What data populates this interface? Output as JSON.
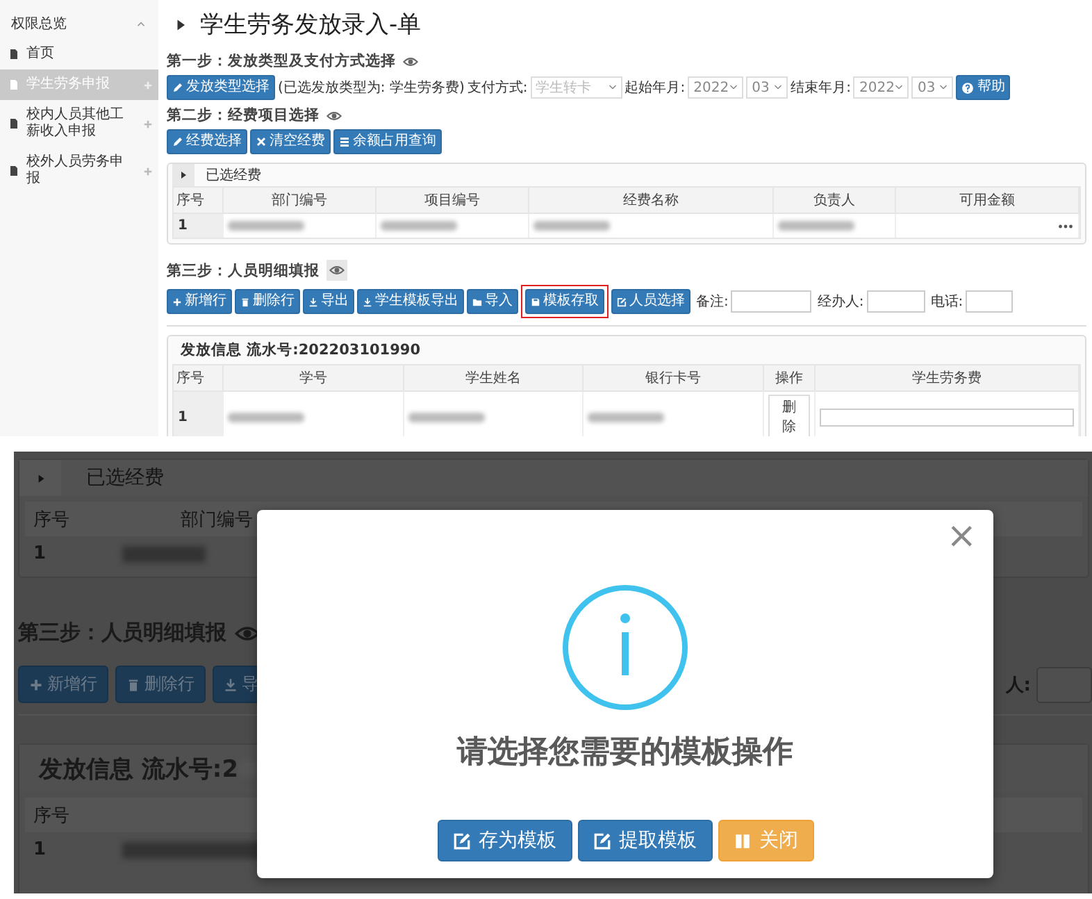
{
  "sidebar": {
    "title": "权限总览",
    "items": [
      {
        "label": "首页",
        "selected": false,
        "expandable": false
      },
      {
        "label": "学生劳务申报",
        "selected": true,
        "expandable": true
      },
      {
        "label": "校内人员其他工薪收入申报",
        "selected": false,
        "expandable": true
      },
      {
        "label": "校外人员劳务申报",
        "selected": false,
        "expandable": true
      }
    ]
  },
  "page_title": "学生劳务发放录入-单",
  "step1": {
    "heading": "第一步：发放类型及支付方式选择",
    "type_button": "发放类型选择",
    "selected_type": "(已选发放类型为: 学生劳务费)",
    "payment_label": "支付方式:",
    "payment_select": {
      "placeholder": "学生转卡"
    },
    "start_label": "起始年月:",
    "start_year": "2022",
    "start_month": "03",
    "end_label": "结束年月:",
    "end_year": "2022",
    "end_month": "03",
    "help_button": "帮助"
  },
  "step2": {
    "heading": "第二步：经费项目选择",
    "buttons": [
      {
        "label": "经费选择"
      },
      {
        "label": "清空经费"
      },
      {
        "label": "余额占用查询"
      }
    ]
  },
  "funds_panel": {
    "title": "已选经费",
    "columns": [
      "序号",
      "部门编号",
      "项目编号",
      "经费名称",
      "负责人",
      "可用金额"
    ],
    "rows": [
      {
        "cells": [
          {
            "kind": "text",
            "text": "1"
          },
          {
            "kind": "blurred"
          },
          {
            "kind": "blurred"
          },
          {
            "kind": "blurred"
          },
          {
            "kind": "blurred"
          },
          {
            "kind": "more"
          }
        ]
      }
    ]
  },
  "step3": {
    "heading": "第三步：人员明细填报",
    "buttons": [
      {
        "label": "新增行",
        "highlighted": false
      },
      {
        "label": "删除行",
        "highlighted": false
      },
      {
        "label": "导出",
        "highlighted": false
      },
      {
        "label": "学生模板导出",
        "highlighted": false
      },
      {
        "label": "导入",
        "highlighted": false
      },
      {
        "label": "模板存取",
        "highlighted": true
      },
      {
        "label": "人员选择",
        "highlighted": false
      }
    ],
    "fields": [
      {
        "label": "备注:"
      },
      {
        "label": "经办人:"
      },
      {
        "label": "电话:"
      }
    ]
  },
  "payment_panel": {
    "title": "发放信息 流水号:202203101990",
    "columns": [
      "序号",
      "学号",
      "学生姓名",
      "银行卡号",
      "操作",
      "学生劳务费"
    ],
    "rows": [
      {
        "cells": [
          {
            "kind": "text",
            "text": "1"
          },
          {
            "kind": "blurred"
          },
          {
            "kind": "blurred"
          },
          {
            "kind": "blurred"
          },
          {
            "kind": "button",
            "text": "删除"
          },
          {
            "kind": "input"
          }
        ]
      }
    ]
  },
  "dialog_view": {
    "background": {
      "funds_title": "已选经费",
      "columns": [
        "序号",
        "部门编号"
      ],
      "row_index": "1",
      "step3_heading": "第三步：人员明细填报",
      "buttons": [
        {
          "label": "新增行"
        },
        {
          "label": "删除行"
        },
        {
          "label": "导"
        }
      ],
      "field_label": "人:",
      "panel_title": "发放信息 流水号:2",
      "table_column": "序号",
      "table_row_index": "1"
    },
    "modal": {
      "close": "×",
      "message": "请选择您需要的模板操作",
      "buttons": [
        {
          "label": "存为模板",
          "kind": "primary"
        },
        {
          "label": "提取模板",
          "kind": "primary"
        },
        {
          "label": "关闭",
          "kind": "warning"
        }
      ]
    }
  }
}
